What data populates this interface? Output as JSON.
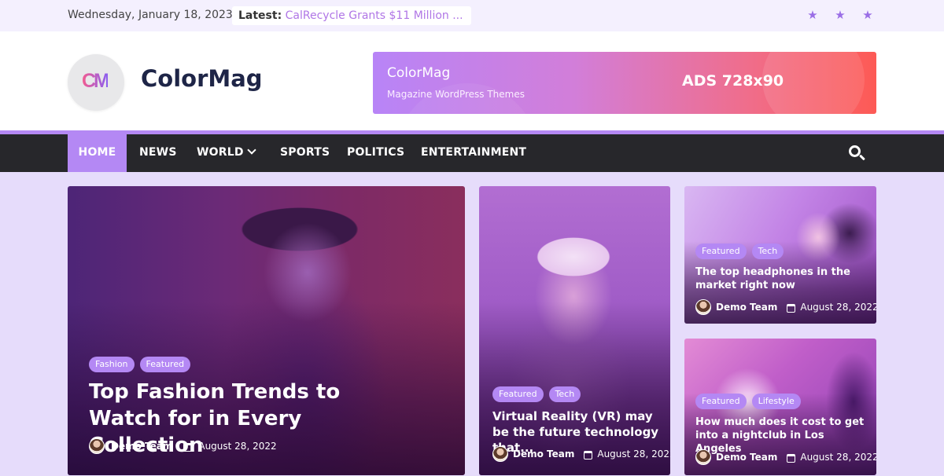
{
  "topbar": {
    "date": "Wednesday, January 18, 2023",
    "latest_label": "Latest:",
    "latest_link": "CalRecycle Grants $11 Million ...",
    "social_icons": [
      "star-icon",
      "star-icon",
      "star-icon"
    ]
  },
  "header": {
    "logo_letters": "CM",
    "site_title": "ColorMag",
    "ad": {
      "brand": "ColorMag",
      "tagline": "Magazine WordPress Themes",
      "size": "ADS 728x90"
    }
  },
  "nav": {
    "items": [
      "HOME",
      "NEWS",
      "WORLD",
      "SPORTS",
      "POLITICS",
      "ENTERTAINMENT"
    ],
    "active": "HOME",
    "accent_color": "#b488f4"
  },
  "cards": [
    {
      "badges": [
        "Fashion",
        "Featured"
      ],
      "title": "Top Fashion Trends to Watch for in Every Collection",
      "author": "Demo Team",
      "date": "August 28, 2022"
    },
    {
      "badges": [
        "Featured",
        "Tech"
      ],
      "title": "Virtual Reality (VR) may be the future technology that...",
      "author": "Demo Team",
      "date": "August 28, 2022"
    },
    {
      "badges": [
        "Featured",
        "Tech"
      ],
      "title": "The top headphones in the market right now",
      "author": "Demo Team",
      "date": "August 28, 2022"
    },
    {
      "badges": [
        "Featured",
        "Lifestyle"
      ],
      "title": "How much does it cost to get into a nightclub in Los Angeles",
      "author": "Demo Team",
      "date": "August 28, 2022"
    }
  ]
}
